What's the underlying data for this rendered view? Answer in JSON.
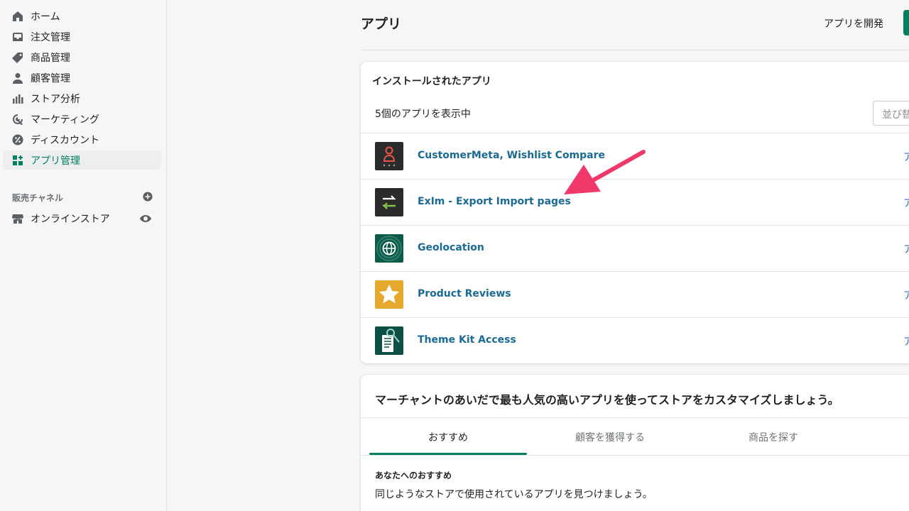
{
  "sidebar": {
    "items": [
      {
        "label": "ホーム",
        "icon": "home-icon"
      },
      {
        "label": "注文管理",
        "icon": "inbox-icon"
      },
      {
        "label": "商品管理",
        "icon": "tag-icon"
      },
      {
        "label": "顧客管理",
        "icon": "person-icon"
      },
      {
        "label": "ストア分析",
        "icon": "bar-chart-icon"
      },
      {
        "label": "マーケティング",
        "icon": "target-icon"
      },
      {
        "label": "ディスカウント",
        "icon": "discount-icon"
      },
      {
        "label": "アプリ管理",
        "icon": "apps-icon",
        "active": true
      }
    ],
    "channels_heading": "販売チャネル",
    "online_store": "オンラインストア"
  },
  "header": {
    "title": "アプリ",
    "develop_link": "アプリを開発"
  },
  "installed": {
    "title": "インストールされたアプリ",
    "count_text": "5個のアプリを表示中",
    "sort_placeholder": "並び替",
    "apps": [
      {
        "name": "CustomerMeta, Wishlist Compare",
        "action": "ア"
      },
      {
        "name": "ExIm - Export Import pages",
        "action": "ア"
      },
      {
        "name": "Geolocation",
        "action": "ア"
      },
      {
        "name": "Product Reviews",
        "action": "ア"
      },
      {
        "name": "Theme Kit Access",
        "action": "ア"
      }
    ]
  },
  "recommend": {
    "title": "マーチャントのあいだで最も人気の高いアプリを使ってストアをカスタマイズしましょう。",
    "tabs": [
      "おすすめ",
      "顧客を獲得する",
      "商品を探す"
    ],
    "sub_heading": "あなたへのおすすめ",
    "sub_text": "同じようなストアで使用されているアプリを見つけましょう。"
  },
  "colors": {
    "accent": "#008060",
    "link": "#1a6a94",
    "annotation_arrow": "#f0386b"
  }
}
